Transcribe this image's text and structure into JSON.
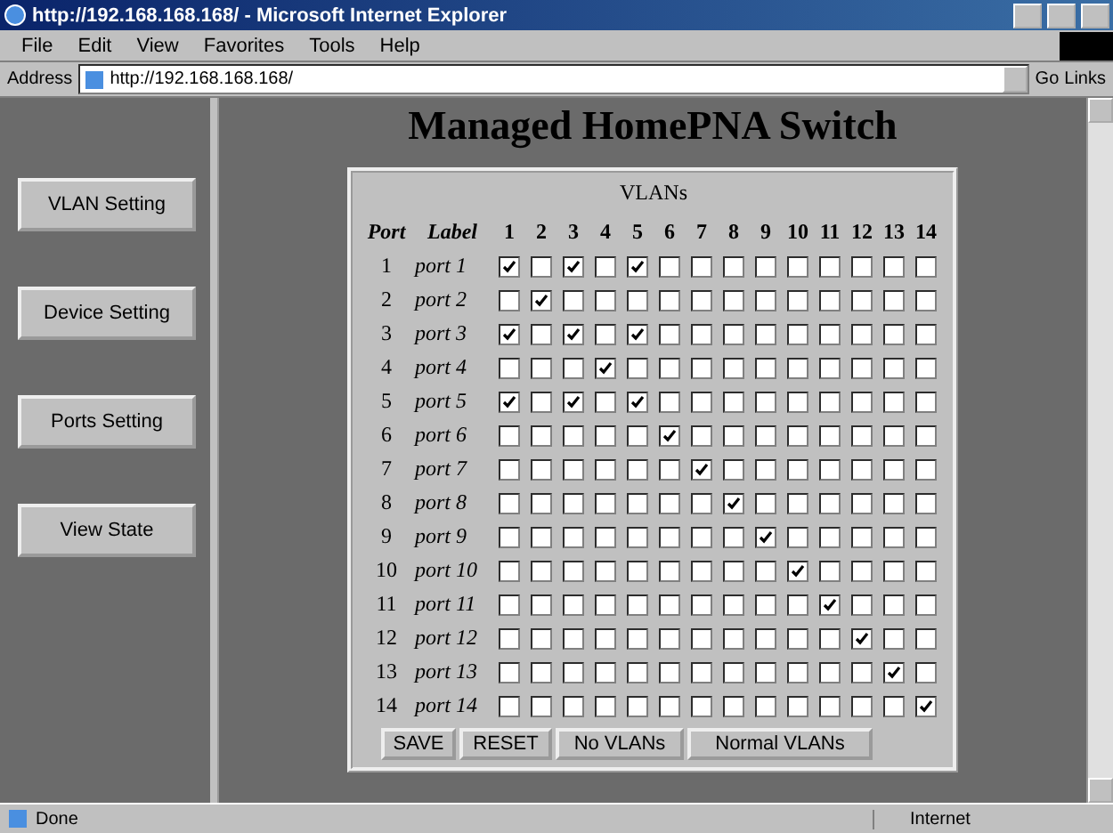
{
  "window": {
    "title": "http://192.168.168.168/ - Microsoft Internet Explorer"
  },
  "menu": [
    "File",
    "Edit",
    "View",
    "Favorites",
    "Tools",
    "Help"
  ],
  "address": {
    "label": "Address",
    "value": "http://192.168.168.168/",
    "go": "Go",
    "links": "Links"
  },
  "sidebar": {
    "buttons": [
      "VLAN Setting",
      "Device Setting",
      "Ports Setting",
      "View State"
    ]
  },
  "page_title": "Managed HomePNA Switch",
  "vlan_table": {
    "caption": "VLANs",
    "columns": [
      "Port",
      "Label"
    ],
    "vlan_ids": [
      "1",
      "2",
      "3",
      "4",
      "5",
      "6",
      "7",
      "8",
      "9",
      "10",
      "11",
      "12",
      "13",
      "14"
    ],
    "rows": [
      {
        "port": "1",
        "label": "port 1",
        "vlans": [
          true,
          false,
          true,
          false,
          true,
          false,
          false,
          false,
          false,
          false,
          false,
          false,
          false,
          false
        ]
      },
      {
        "port": "2",
        "label": "port 2",
        "vlans": [
          false,
          true,
          false,
          false,
          false,
          false,
          false,
          false,
          false,
          false,
          false,
          false,
          false,
          false
        ]
      },
      {
        "port": "3",
        "label": "port 3",
        "vlans": [
          true,
          false,
          true,
          false,
          true,
          false,
          false,
          false,
          false,
          false,
          false,
          false,
          false,
          false
        ]
      },
      {
        "port": "4",
        "label": "port 4",
        "vlans": [
          false,
          false,
          false,
          true,
          false,
          false,
          false,
          false,
          false,
          false,
          false,
          false,
          false,
          false
        ]
      },
      {
        "port": "5",
        "label": "port 5",
        "vlans": [
          true,
          false,
          true,
          false,
          true,
          false,
          false,
          false,
          false,
          false,
          false,
          false,
          false,
          false
        ]
      },
      {
        "port": "6",
        "label": "port 6",
        "vlans": [
          false,
          false,
          false,
          false,
          false,
          true,
          false,
          false,
          false,
          false,
          false,
          false,
          false,
          false
        ]
      },
      {
        "port": "7",
        "label": "port 7",
        "vlans": [
          false,
          false,
          false,
          false,
          false,
          false,
          true,
          false,
          false,
          false,
          false,
          false,
          false,
          false
        ]
      },
      {
        "port": "8",
        "label": "port 8",
        "vlans": [
          false,
          false,
          false,
          false,
          false,
          false,
          false,
          true,
          false,
          false,
          false,
          false,
          false,
          false
        ]
      },
      {
        "port": "9",
        "label": "port 9",
        "vlans": [
          false,
          false,
          false,
          false,
          false,
          false,
          false,
          false,
          true,
          false,
          false,
          false,
          false,
          false
        ]
      },
      {
        "port": "10",
        "label": "port 10",
        "vlans": [
          false,
          false,
          false,
          false,
          false,
          false,
          false,
          false,
          false,
          true,
          false,
          false,
          false,
          false
        ]
      },
      {
        "port": "11",
        "label": "port 11",
        "vlans": [
          false,
          false,
          false,
          false,
          false,
          false,
          false,
          false,
          false,
          false,
          true,
          false,
          false,
          false
        ]
      },
      {
        "port": "12",
        "label": "port 12",
        "vlans": [
          false,
          false,
          false,
          false,
          false,
          false,
          false,
          false,
          false,
          false,
          false,
          true,
          false,
          false
        ]
      },
      {
        "port": "13",
        "label": "port 13",
        "vlans": [
          false,
          false,
          false,
          false,
          false,
          false,
          false,
          false,
          false,
          false,
          false,
          false,
          true,
          false
        ]
      },
      {
        "port": "14",
        "label": "port 14",
        "vlans": [
          false,
          false,
          false,
          false,
          false,
          false,
          false,
          false,
          false,
          false,
          false,
          false,
          false,
          true
        ]
      }
    ],
    "buttons": [
      "SAVE",
      "RESET",
      "No VLANs",
      "Normal VLANs"
    ]
  },
  "status_bar": {
    "text": "Done",
    "zone": "Internet"
  }
}
